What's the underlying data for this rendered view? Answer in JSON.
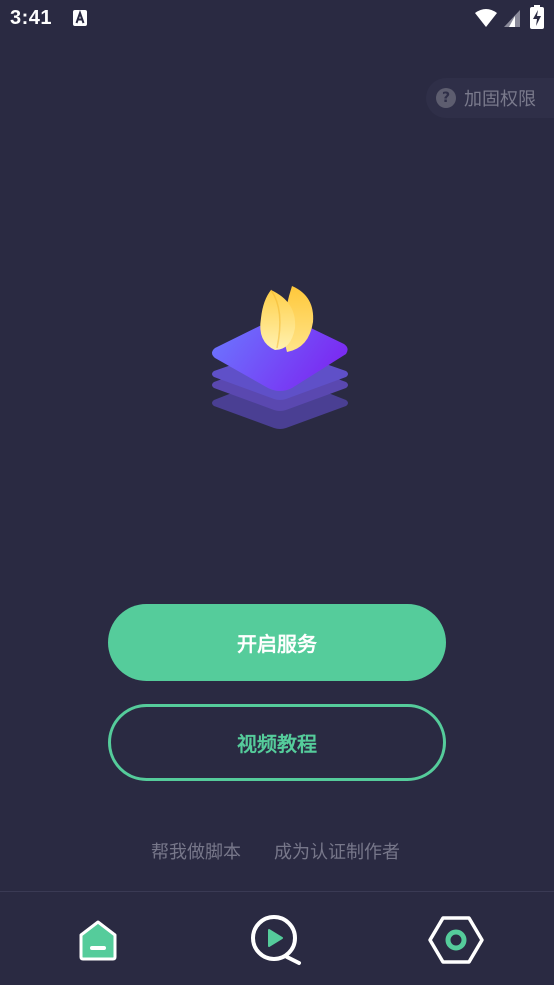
{
  "status_bar": {
    "time": "3:41",
    "icons": [
      "a-notification-icon",
      "wifi-icon",
      "signal-icon",
      "battery-charging-icon"
    ]
  },
  "permission_chip": {
    "icon": "help-icon",
    "icon_glyph": "?",
    "label": "加固权限"
  },
  "logo": {
    "icon": "app-logo-stack-leaf-icon"
  },
  "buttons": {
    "start_service": "开启服务",
    "video_tutorial": "视频教程"
  },
  "links": {
    "help_script": "帮我做脚本",
    "become_author": "成为认证制作者"
  },
  "bottom_nav": {
    "items": [
      {
        "icon": "home-icon",
        "selected": true
      },
      {
        "icon": "video-play-icon",
        "selected": false
      },
      {
        "icon": "settings-hexagon-icon",
        "selected": false
      }
    ]
  },
  "colors": {
    "background": "#2a2a42",
    "accent": "#55cc9b",
    "muted_text": "#77778a",
    "chip_bg": "#2f2f48"
  }
}
